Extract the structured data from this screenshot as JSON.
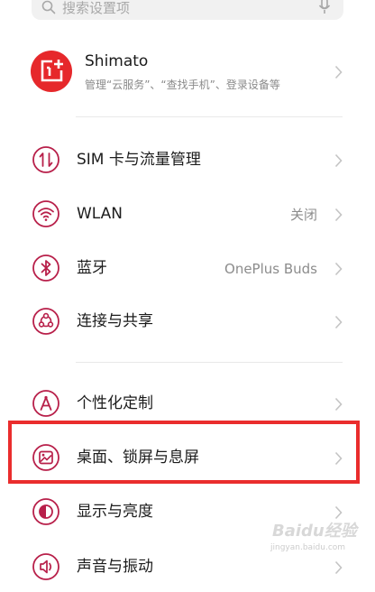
{
  "search": {
    "placeholder": "搜索设置项"
  },
  "account": {
    "name": "Shimato",
    "subtitle": "管理“云服务”、“查找手机”、登录设备等"
  },
  "settings": [
    {
      "label": "SIM 卡与流量管理",
      "value": ""
    },
    {
      "label": "WLAN",
      "value": "关闭"
    },
    {
      "label": "蓝牙",
      "value": "OnePlus Buds"
    },
    {
      "label": "连接与共享",
      "value": ""
    },
    {
      "label": "个性化定制",
      "value": ""
    },
    {
      "label": "桌面、锁屏与息屏",
      "value": ""
    },
    {
      "label": "显示与亮度",
      "value": ""
    },
    {
      "label": "声音与振动",
      "value": ""
    }
  ],
  "watermark": {
    "text": "Baidu经验",
    "url": "jingyan.baidu.com"
  },
  "colors": {
    "accent": "#b8204a",
    "brand": "#e6282b",
    "highlight": "#ea2d2d"
  },
  "icons": [
    "search-icon",
    "mic-icon",
    "sim-icon",
    "wifi-icon",
    "bluetooth-icon",
    "share-icon",
    "personalize-icon",
    "wallpaper-icon",
    "display-icon",
    "sound-icon",
    "chevron-right-icon"
  ]
}
